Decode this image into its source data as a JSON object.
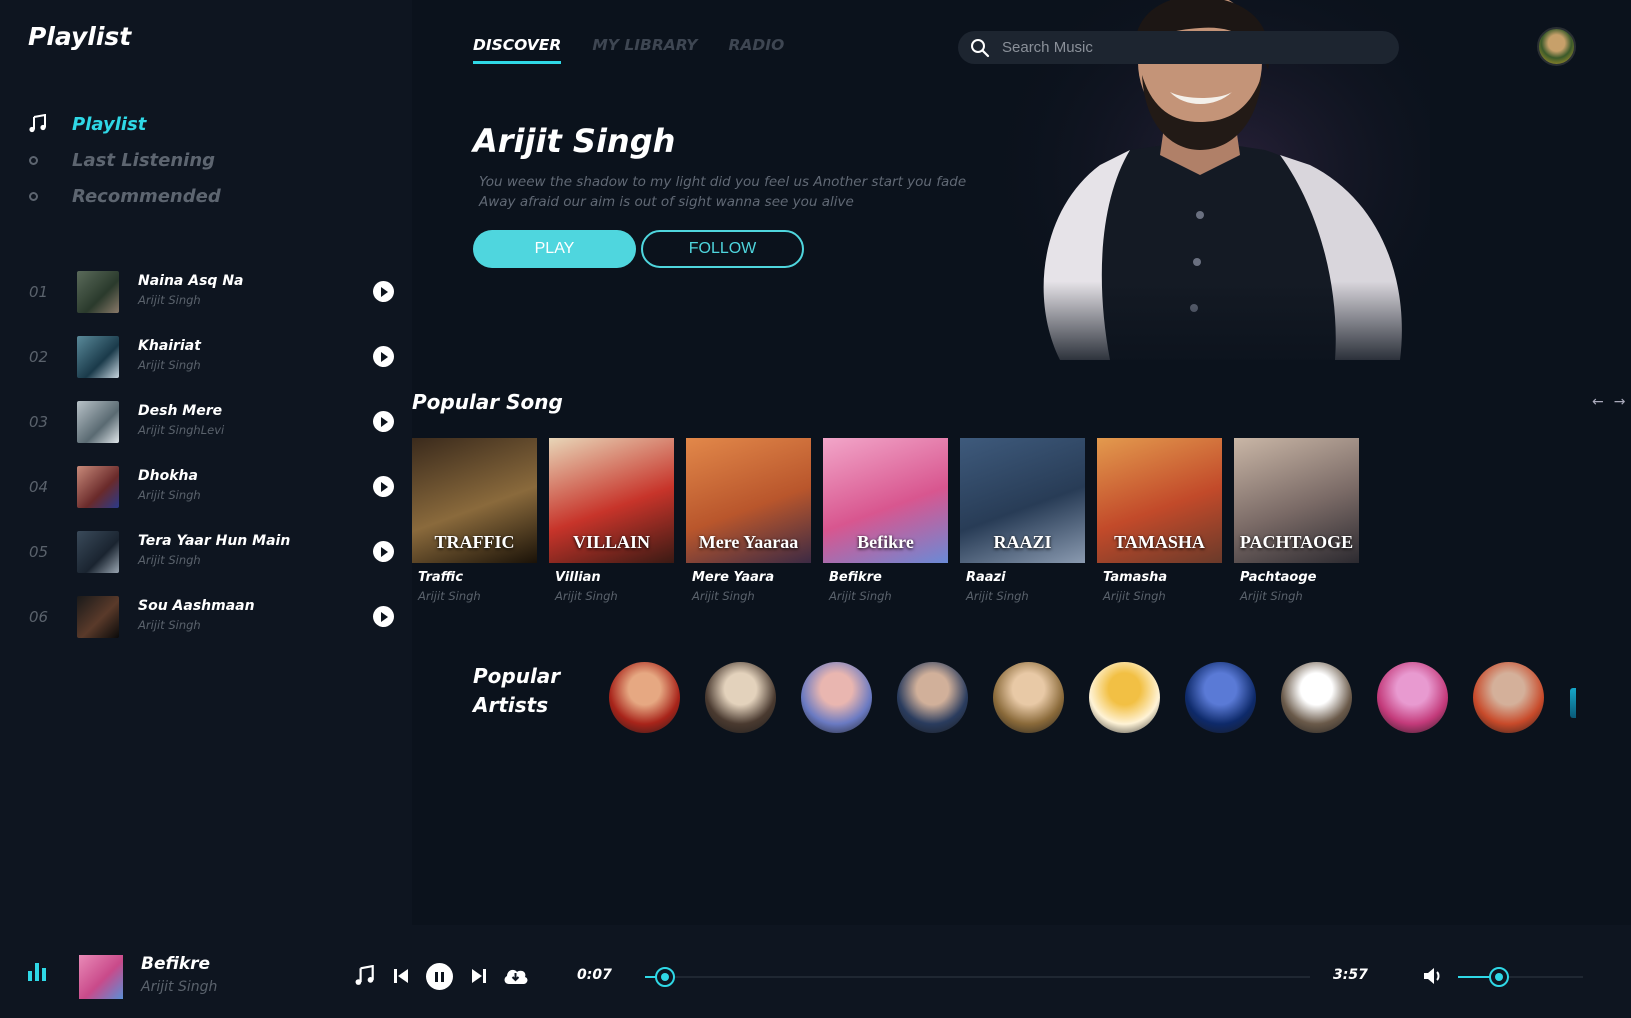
{
  "sidebar": {
    "logo": "Playlist",
    "nav": [
      {
        "label": "Playlist",
        "active": true
      },
      {
        "label": "Last Listening",
        "active": false
      },
      {
        "label": "Recommended",
        "active": false
      }
    ],
    "tracks": [
      {
        "num": "01",
        "title": "Naina Asq Na",
        "artist": "Arijit Singh"
      },
      {
        "num": "02",
        "title": "Khairiat",
        "artist": "Arijit Singh"
      },
      {
        "num": "03",
        "title": "Desh Mere",
        "artist": "Arijit SinghLevi"
      },
      {
        "num": "04",
        "title": "Dhokha",
        "artist": "Arijit Singh"
      },
      {
        "num": "05",
        "title": "Tera Yaar Hun Main",
        "artist": "Arijit Singh"
      },
      {
        "num": "06",
        "title": "Sou Aashmaan",
        "artist": "Arijit Singh"
      }
    ]
  },
  "header": {
    "tabs": [
      "DISCOVER",
      "MY LIBRARY",
      "RADIO"
    ],
    "search_placeholder": "Search Music"
  },
  "hero": {
    "artist": "Arijit Singh",
    "description": "You weew the shadow to my light did you feel us Another start you fade Away afraid our aim is out of sight wanna see you alive",
    "play_label": "PLAY",
    "follow_label": "FOLLOW"
  },
  "popular_songs": {
    "title": "Popular Song",
    "items": [
      {
        "title": "Traffic",
        "artist": "Arijit Singh",
        "cover_text": "TRAFFIC",
        "colors": [
          "#3a2a1c",
          "#8a6a3c",
          "#1a1208"
        ]
      },
      {
        "title": "Villian",
        "artist": "Arijit Singh",
        "cover_text": "VILLAIN",
        "colors": [
          "#e8d6b8",
          "#c7342a",
          "#3a1a14"
        ]
      },
      {
        "title": "Mere Yaara",
        "artist": "Arijit Singh",
        "cover_text": "Mere Yaaraa",
        "colors": [
          "#e2884a",
          "#b9562c",
          "#3c2a44"
        ]
      },
      {
        "title": "Befikre",
        "artist": "Arijit Singh",
        "cover_text": "Befikre",
        "colors": [
          "#f2a6c9",
          "#d8568f",
          "#6a8ad6"
        ]
      },
      {
        "title": "Raazi",
        "artist": "Arijit Singh",
        "cover_text": "RAAZI",
        "colors": [
          "#3e5a7c",
          "#283c56",
          "#8a9ab0"
        ]
      },
      {
        "title": "Tamasha",
        "artist": "Arijit Singh",
        "cover_text": "TAMASHA",
        "colors": [
          "#e39a4e",
          "#c24a2a",
          "#6a3a2a"
        ]
      },
      {
        "title": "Pachtaoge",
        "artist": "Arijit Singh",
        "cover_text": "PACHTAOGE",
        "colors": [
          "#c9b6a6",
          "#7a6a66",
          "#2c2a30"
        ]
      }
    ]
  },
  "popular_artists": {
    "title_line1": "Popular",
    "title_line2": "Artists",
    "items": [
      {
        "colors": [
          "#e6a882",
          "#a8241a"
        ]
      },
      {
        "colors": [
          "#e3d2bc",
          "#4a3a30"
        ]
      },
      {
        "colors": [
          "#e9b6b0",
          "#6a7ac2"
        ]
      },
      {
        "colors": [
          "#d1b09a",
          "#2a3c5e"
        ]
      },
      {
        "colors": [
          "#e8c9a6",
          "#8a6a3a"
        ]
      },
      {
        "colors": [
          "#f2c044",
          "#fff3d6"
        ]
      },
      {
        "colors": [
          "#5a7ad6",
          "#0e2a6a"
        ]
      },
      {
        "colors": [
          "#ffffff",
          "#6a5a4a"
        ]
      },
      {
        "colors": [
          "#e89ad0",
          "#c33a7a"
        ]
      },
      {
        "colors": [
          "#d4b09a",
          "#c84a2a"
        ]
      }
    ]
  },
  "player": {
    "now_playing_title": "Befikre",
    "now_playing_artist": "Arijit Singh",
    "current_time": "0:07",
    "total_time": "3:57",
    "progress_fraction": 0.03,
    "volume_fraction": 0.33
  },
  "colors": {
    "accent": "#2fd8e6",
    "background": "#0b121c",
    "panel": "#0e1520",
    "muted_text": "#5a626c"
  }
}
